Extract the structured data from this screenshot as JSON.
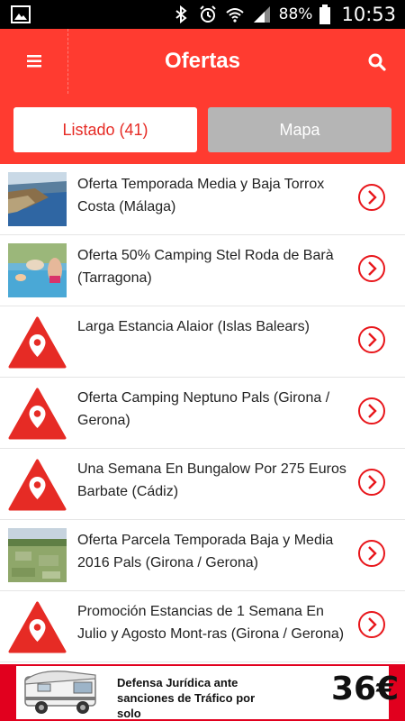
{
  "status_bar": {
    "battery_percent": "88%",
    "time": "10:53",
    "icons": [
      "gallery-icon",
      "bluetooth-icon",
      "alarm-icon",
      "wifi-icon",
      "signal-icon",
      "battery-icon"
    ]
  },
  "app_bar": {
    "title": "Ofertas",
    "menu_icon": "hamburger-menu-icon",
    "search_icon": "search-icon",
    "color": "#ff3b30"
  },
  "tabs": {
    "listado_label": "Listado (41)",
    "mapa_label": "Mapa",
    "active": "listado"
  },
  "offers": [
    {
      "title": "Oferta Temporada Media y Baja Torrox Costa (Málaga)",
      "thumb": "coast-photo"
    },
    {
      "title": "Oferta 50% Camping Stel Roda de Barà (Tarragona)",
      "thumb": "pool-photo"
    },
    {
      "title": "Larga Estancia Alaior (Islas Balears)",
      "thumb": "camping-logo-icon"
    },
    {
      "title": "Oferta Camping Neptuno Pals (Girona / Gerona)",
      "thumb": "camping-logo-icon"
    },
    {
      "title": "Una Semana En Bungalow Por 275 Euros Barbate (Cádiz)",
      "thumb": "camping-logo-icon"
    },
    {
      "title": "Oferta Parcela Temporada Baja y Media 2016 Pals (Girona / Gerona)",
      "thumb": "field-photo"
    },
    {
      "title": "Promoción Estancias de 1 Semana En Julio y Agosto Mont-ras (Girona / Gerona)",
      "thumb": "camping-logo-icon"
    }
  ],
  "banner": {
    "line1": "Defensa Jurídica ante",
    "line2": "sanciones de Tráfico por solo",
    "price": "36€",
    "image": "motorhome-image"
  }
}
